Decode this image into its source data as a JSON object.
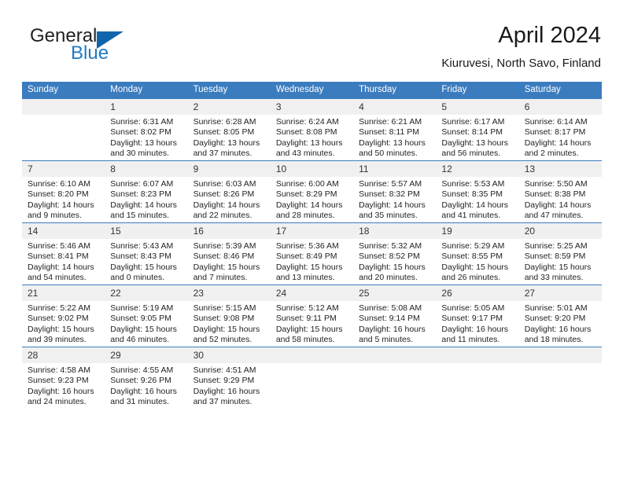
{
  "brand": {
    "word1": "General",
    "word2": "Blue",
    "triangle_icon": "brand-triangle-icon",
    "color_primary": "#1064ab",
    "color_secondary": "#1f7ac4"
  },
  "header": {
    "title": "April 2024",
    "subtitle": "Kiuruvesi, North Savo, Finland"
  },
  "theme": {
    "header_bg": "#3b7cbf",
    "daynum_bg": "#f0f0f0",
    "grid_line": "#3b7cbf"
  },
  "calendar": {
    "weekday_headers": [
      "Sunday",
      "Monday",
      "Tuesday",
      "Wednesday",
      "Thursday",
      "Friday",
      "Saturday"
    ],
    "weeks": [
      [
        {
          "day": "",
          "blank": true,
          "sunrise": "",
          "sunset": "",
          "daylight": ""
        },
        {
          "day": "1",
          "sunrise": "Sunrise: 6:31 AM",
          "sunset": "Sunset: 8:02 PM",
          "daylight": "Daylight: 13 hours and 30 minutes."
        },
        {
          "day": "2",
          "sunrise": "Sunrise: 6:28 AM",
          "sunset": "Sunset: 8:05 PM",
          "daylight": "Daylight: 13 hours and 37 minutes."
        },
        {
          "day": "3",
          "sunrise": "Sunrise: 6:24 AM",
          "sunset": "Sunset: 8:08 PM",
          "daylight": "Daylight: 13 hours and 43 minutes."
        },
        {
          "day": "4",
          "sunrise": "Sunrise: 6:21 AM",
          "sunset": "Sunset: 8:11 PM",
          "daylight": "Daylight: 13 hours and 50 minutes."
        },
        {
          "day": "5",
          "sunrise": "Sunrise: 6:17 AM",
          "sunset": "Sunset: 8:14 PM",
          "daylight": "Daylight: 13 hours and 56 minutes."
        },
        {
          "day": "6",
          "sunrise": "Sunrise: 6:14 AM",
          "sunset": "Sunset: 8:17 PM",
          "daylight": "Daylight: 14 hours and 2 minutes."
        }
      ],
      [
        {
          "day": "7",
          "sunrise": "Sunrise: 6:10 AM",
          "sunset": "Sunset: 8:20 PM",
          "daylight": "Daylight: 14 hours and 9 minutes."
        },
        {
          "day": "8",
          "sunrise": "Sunrise: 6:07 AM",
          "sunset": "Sunset: 8:23 PM",
          "daylight": "Daylight: 14 hours and 15 minutes."
        },
        {
          "day": "9",
          "sunrise": "Sunrise: 6:03 AM",
          "sunset": "Sunset: 8:26 PM",
          "daylight": "Daylight: 14 hours and 22 minutes."
        },
        {
          "day": "10",
          "sunrise": "Sunrise: 6:00 AM",
          "sunset": "Sunset: 8:29 PM",
          "daylight": "Daylight: 14 hours and 28 minutes."
        },
        {
          "day": "11",
          "sunrise": "Sunrise: 5:57 AM",
          "sunset": "Sunset: 8:32 PM",
          "daylight": "Daylight: 14 hours and 35 minutes."
        },
        {
          "day": "12",
          "sunrise": "Sunrise: 5:53 AM",
          "sunset": "Sunset: 8:35 PM",
          "daylight": "Daylight: 14 hours and 41 minutes."
        },
        {
          "day": "13",
          "sunrise": "Sunrise: 5:50 AM",
          "sunset": "Sunset: 8:38 PM",
          "daylight": "Daylight: 14 hours and 47 minutes."
        }
      ],
      [
        {
          "day": "14",
          "sunrise": "Sunrise: 5:46 AM",
          "sunset": "Sunset: 8:41 PM",
          "daylight": "Daylight: 14 hours and 54 minutes."
        },
        {
          "day": "15",
          "sunrise": "Sunrise: 5:43 AM",
          "sunset": "Sunset: 8:43 PM",
          "daylight": "Daylight: 15 hours and 0 minutes."
        },
        {
          "day": "16",
          "sunrise": "Sunrise: 5:39 AM",
          "sunset": "Sunset: 8:46 PM",
          "daylight": "Daylight: 15 hours and 7 minutes."
        },
        {
          "day": "17",
          "sunrise": "Sunrise: 5:36 AM",
          "sunset": "Sunset: 8:49 PM",
          "daylight": "Daylight: 15 hours and 13 minutes."
        },
        {
          "day": "18",
          "sunrise": "Sunrise: 5:32 AM",
          "sunset": "Sunset: 8:52 PM",
          "daylight": "Daylight: 15 hours and 20 minutes."
        },
        {
          "day": "19",
          "sunrise": "Sunrise: 5:29 AM",
          "sunset": "Sunset: 8:55 PM",
          "daylight": "Daylight: 15 hours and 26 minutes."
        },
        {
          "day": "20",
          "sunrise": "Sunrise: 5:25 AM",
          "sunset": "Sunset: 8:59 PM",
          "daylight": "Daylight: 15 hours and 33 minutes."
        }
      ],
      [
        {
          "day": "21",
          "sunrise": "Sunrise: 5:22 AM",
          "sunset": "Sunset: 9:02 PM",
          "daylight": "Daylight: 15 hours and 39 minutes."
        },
        {
          "day": "22",
          "sunrise": "Sunrise: 5:19 AM",
          "sunset": "Sunset: 9:05 PM",
          "daylight": "Daylight: 15 hours and 46 minutes."
        },
        {
          "day": "23",
          "sunrise": "Sunrise: 5:15 AM",
          "sunset": "Sunset: 9:08 PM",
          "daylight": "Daylight: 15 hours and 52 minutes."
        },
        {
          "day": "24",
          "sunrise": "Sunrise: 5:12 AM",
          "sunset": "Sunset: 9:11 PM",
          "daylight": "Daylight: 15 hours and 58 minutes."
        },
        {
          "day": "25",
          "sunrise": "Sunrise: 5:08 AM",
          "sunset": "Sunset: 9:14 PM",
          "daylight": "Daylight: 16 hours and 5 minutes."
        },
        {
          "day": "26",
          "sunrise": "Sunrise: 5:05 AM",
          "sunset": "Sunset: 9:17 PM",
          "daylight": "Daylight: 16 hours and 11 minutes."
        },
        {
          "day": "27",
          "sunrise": "Sunrise: 5:01 AM",
          "sunset": "Sunset: 9:20 PM",
          "daylight": "Daylight: 16 hours and 18 minutes."
        }
      ],
      [
        {
          "day": "28",
          "sunrise": "Sunrise: 4:58 AM",
          "sunset": "Sunset: 9:23 PM",
          "daylight": "Daylight: 16 hours and 24 minutes."
        },
        {
          "day": "29",
          "sunrise": "Sunrise: 4:55 AM",
          "sunset": "Sunset: 9:26 PM",
          "daylight": "Daylight: 16 hours and 31 minutes."
        },
        {
          "day": "30",
          "sunrise": "Sunrise: 4:51 AM",
          "sunset": "Sunset: 9:29 PM",
          "daylight": "Daylight: 16 hours and 37 minutes."
        },
        {
          "day": "",
          "blank": true,
          "sunrise": "",
          "sunset": "",
          "daylight": ""
        },
        {
          "day": "",
          "blank": true,
          "sunrise": "",
          "sunset": "",
          "daylight": ""
        },
        {
          "day": "",
          "blank": true,
          "sunrise": "",
          "sunset": "",
          "daylight": ""
        },
        {
          "day": "",
          "blank": true,
          "sunrise": "",
          "sunset": "",
          "daylight": ""
        }
      ]
    ]
  }
}
